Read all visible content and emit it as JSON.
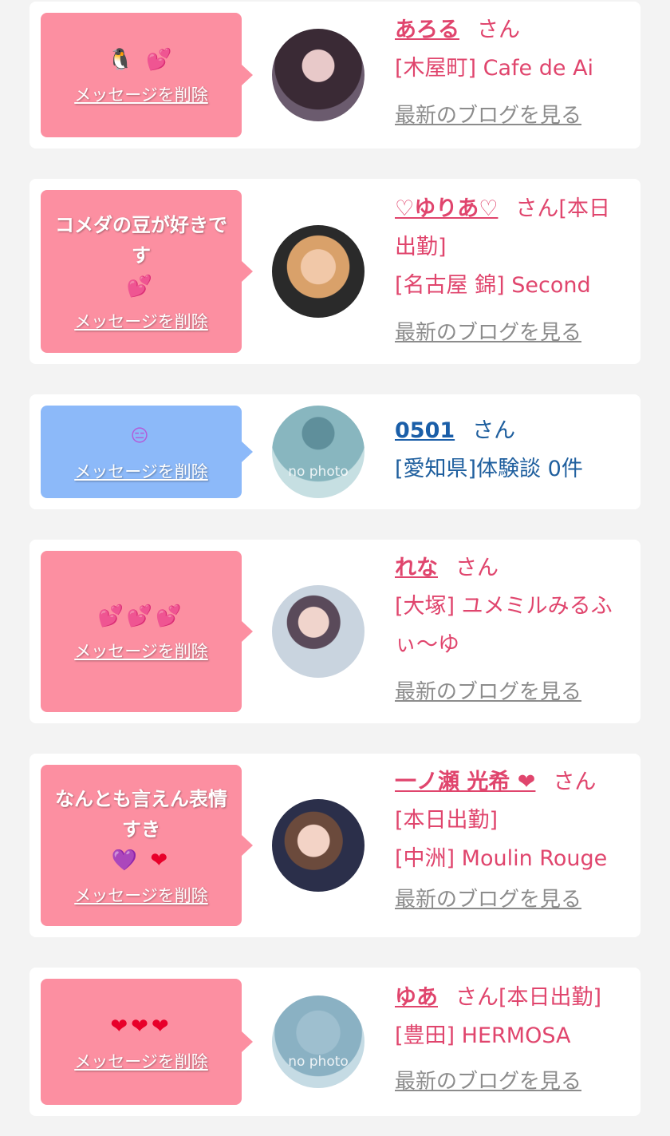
{
  "delete_label": "メッセージを削除",
  "blog_label": "最新のブログを見る",
  "cards": [
    {
      "name": "あろる",
      "suffix": "さん",
      "shop": "[木屋町] Cafe de Ai",
      "message": "",
      "emoji": "🐧 💕",
      "avatar": "photo",
      "bubble": "pink"
    },
    {
      "name": "♡ゆりあ♡",
      "suffix": "さん[本日出勤]",
      "shop": "[名古屋 錦] Second",
      "message": "コメダの豆が好きです",
      "emoji": "💕",
      "avatar": "photo",
      "bubble": "pink"
    },
    {
      "name": "0501",
      "suffix": "さん",
      "shop": "[愛知県]体験談 0件",
      "message": "",
      "emoji": "😑",
      "avatar": "no photo",
      "bubble": "blue"
    },
    {
      "name": "れな",
      "suffix": "さん",
      "shop": "[大塚] ユメミルみるふぃ〜ゆ",
      "message": "",
      "emoji": "💕💕💕",
      "avatar": "photo",
      "bubble": "pink"
    },
    {
      "name": "一ノ瀬 光希 ❤",
      "suffix": "さん",
      "status": "[本日出勤]",
      "shop": "[中洲] Moulin Rouge",
      "message": "なんとも言えん表情すき",
      "emoji": "💜 ❤",
      "avatar": "photo",
      "bubble": "pink"
    },
    {
      "name": "ゆあ",
      "suffix": "さん[本日出勤]",
      "shop": "[豊田] HERMOSA",
      "message": "",
      "emoji": "❤❤❤",
      "avatar": "no photo",
      "bubble": "pink"
    }
  ],
  "colors": {
    "pink_bubble": "#fc8fa1",
    "blue_bubble": "#8cb9f9",
    "name_pink": "#e0456d",
    "name_blue": "#1a5ea8"
  }
}
